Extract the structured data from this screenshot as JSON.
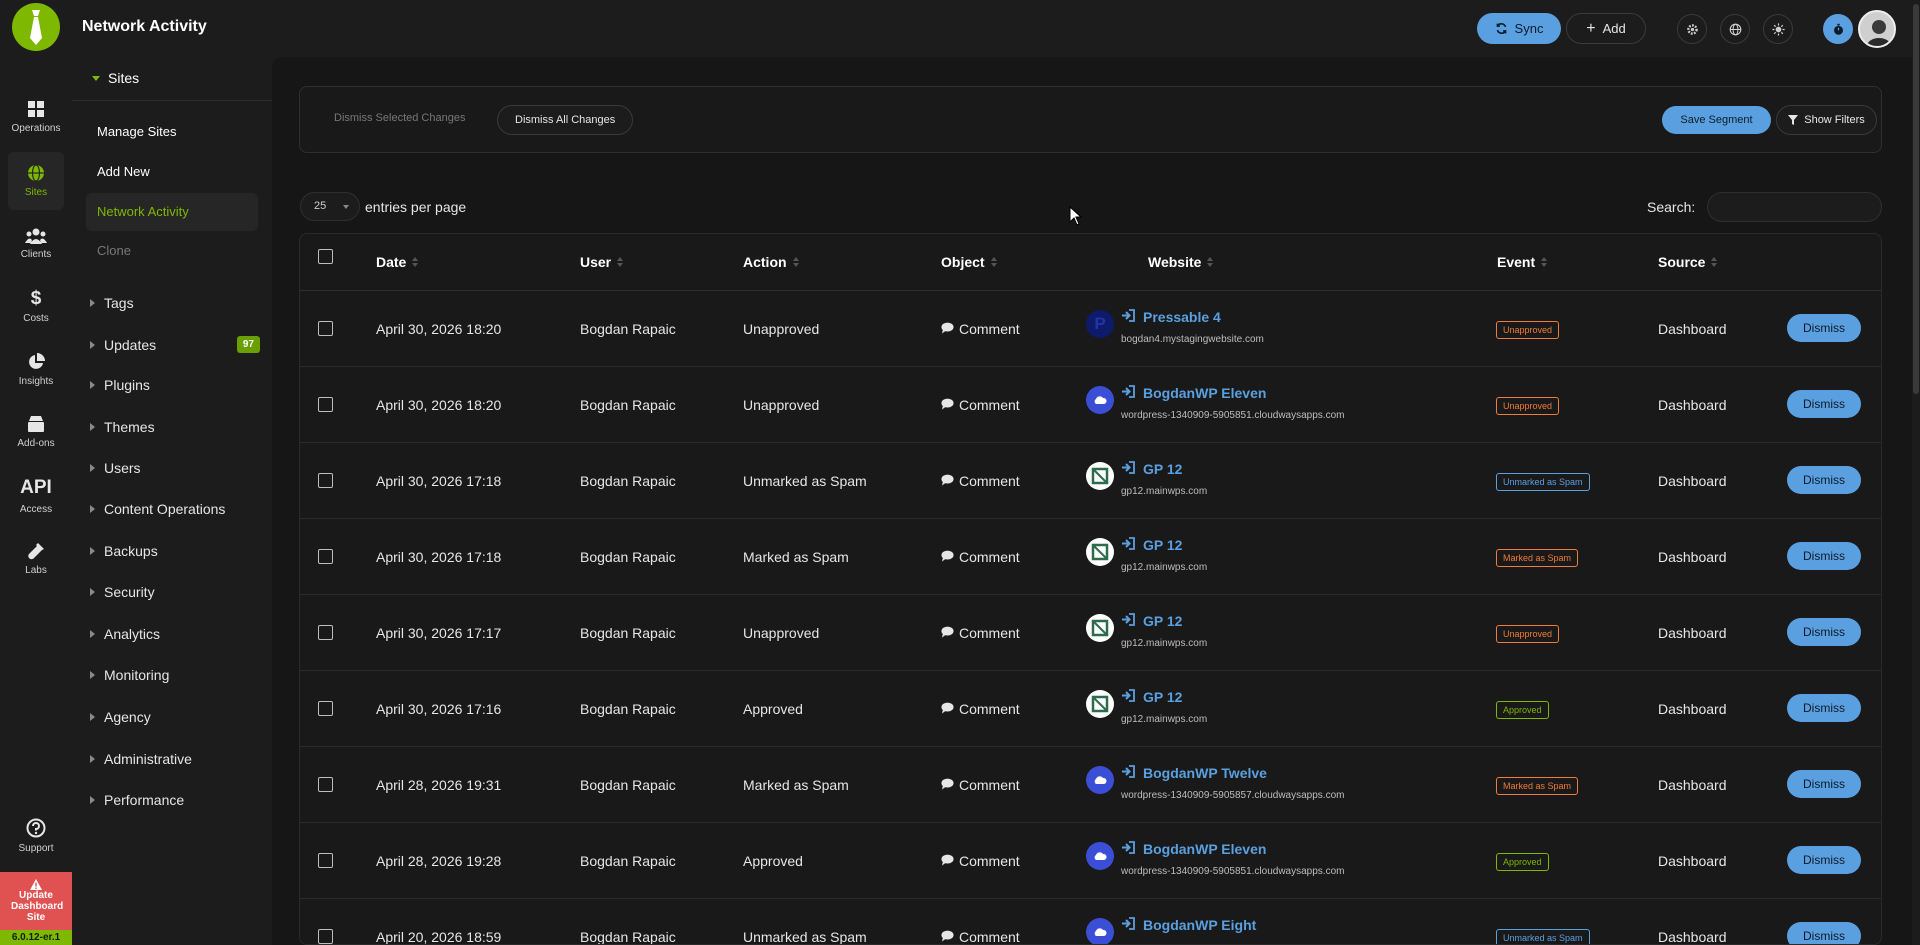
{
  "app": {
    "title": "Network Activity",
    "sync_label": "Sync",
    "add_label": "Add",
    "version": "6.0.12-er.1",
    "update_notice": "Update Dashboard Site"
  },
  "rail": [
    {
      "label": "Operations",
      "icon": "grid-icon"
    },
    {
      "label": "Sites",
      "icon": "globe-icon"
    },
    {
      "label": "Clients",
      "icon": "users-icon"
    },
    {
      "label": "Costs",
      "icon": "dollar-icon"
    },
    {
      "label": "Insights",
      "icon": "pie-chart-icon"
    },
    {
      "label": "Add-ons",
      "icon": "box-icon"
    },
    {
      "label": "Access",
      "icon": "api-icon",
      "text": "API"
    },
    {
      "label": "Labs",
      "icon": "flask-icon"
    },
    {
      "label": "Support",
      "icon": "help-icon"
    }
  ],
  "sidebar": {
    "section": "Sites",
    "sub_items": [
      "Manage Sites",
      "Add New",
      "Network Activity",
      "Clone"
    ],
    "groups": [
      {
        "label": "Tags"
      },
      {
        "label": "Updates",
        "badge": "97"
      },
      {
        "label": "Plugins"
      },
      {
        "label": "Themes"
      },
      {
        "label": "Users"
      },
      {
        "label": "Content Operations"
      },
      {
        "label": "Backups"
      },
      {
        "label": "Security"
      },
      {
        "label": "Analytics"
      },
      {
        "label": "Monitoring"
      },
      {
        "label": "Agency"
      },
      {
        "label": "Administrative"
      },
      {
        "label": "Performance"
      }
    ]
  },
  "filters": {
    "dismiss_selected": "Dismiss Selected Changes",
    "dismiss_all": "Dismiss All Changes",
    "save_segment": "Save Segment",
    "show_filters": "Show Filters"
  },
  "table_controls": {
    "entries_value": "25",
    "entries_label": "entries per page",
    "search_label": "Search:"
  },
  "columns": [
    "Date",
    "User",
    "Action",
    "Object",
    "Website",
    "Event",
    "Source"
  ],
  "rows": [
    {
      "date": "April 30, 2026 18:20",
      "user": "Bogdan Rapaic",
      "action": "Unapproved",
      "object": "Comment",
      "host": "pressable",
      "site": "Pressable 4",
      "url": "bogdan4.mystagingwebsite.com",
      "event": "Unapproved",
      "event_color": "orange",
      "source": "Dashboard",
      "btn": "Dismiss"
    },
    {
      "date": "April 30, 2026 18:20",
      "user": "Bogdan Rapaic",
      "action": "Unapproved",
      "object": "Comment",
      "host": "cloudways",
      "site": "BogdanWP Eleven",
      "url": "wordpress-1340909-5905851.cloudwaysapps.com",
      "event": "Unapproved",
      "event_color": "orange",
      "source": "Dashboard",
      "btn": "Dismiss"
    },
    {
      "date": "April 30, 2026 17:18",
      "user": "Bogdan Rapaic",
      "action": "Unmarked as Spam",
      "object": "Comment",
      "host": "gridpane",
      "site": "GP 12",
      "url": "gp12.mainwps.com",
      "event": "Unmarked as Spam",
      "event_color": "blue",
      "source": "Dashboard",
      "btn": "Dismiss"
    },
    {
      "date": "April 30, 2026 17:18",
      "user": "Bogdan Rapaic",
      "action": "Marked as Spam",
      "object": "Comment",
      "host": "gridpane",
      "site": "GP 12",
      "url": "gp12.mainwps.com",
      "event": "Marked as Spam",
      "event_color": "orange",
      "source": "Dashboard",
      "btn": "Dismiss"
    },
    {
      "date": "April 30, 2026 17:17",
      "user": "Bogdan Rapaic",
      "action": "Unapproved",
      "object": "Comment",
      "host": "gridpane",
      "site": "GP 12",
      "url": "gp12.mainwps.com",
      "event": "Unapproved",
      "event_color": "orange",
      "source": "Dashboard",
      "btn": "Dismiss"
    },
    {
      "date": "April 30, 2026 17:16",
      "user": "Bogdan Rapaic",
      "action": "Approved",
      "object": "Comment",
      "host": "gridpane",
      "site": "GP 12",
      "url": "gp12.mainwps.com",
      "event": "Approved",
      "event_color": "green",
      "source": "Dashboard",
      "btn": "Dismiss"
    },
    {
      "date": "April 28, 2026 19:31",
      "user": "Bogdan Rapaic",
      "action": "Marked as Spam",
      "object": "Comment",
      "host": "cloudways",
      "site": "BogdanWP Twelve",
      "url": "wordpress-1340909-5905857.cloudwaysapps.com",
      "event": "Marked as Spam",
      "event_color": "orange",
      "source": "Dashboard",
      "btn": "Dismiss"
    },
    {
      "date": "April 28, 2026 19:28",
      "user": "Bogdan Rapaic",
      "action": "Approved",
      "object": "Comment",
      "host": "cloudways",
      "site": "BogdanWP Eleven",
      "url": "wordpress-1340909-5905851.cloudwaysapps.com",
      "event": "Approved",
      "event_color": "green",
      "source": "Dashboard",
      "btn": "Dismiss"
    },
    {
      "date": "April 20, 2026 18:59",
      "user": "Bogdan Rapaic",
      "action": "Unmarked as Spam",
      "object": "Comment",
      "host": "cloudways",
      "site": "BogdanWP Eight",
      "url": "",
      "event": "Unmarked as Spam",
      "event_color": "blue",
      "source": "Dashboard",
      "btn": "Dismiss"
    }
  ]
}
